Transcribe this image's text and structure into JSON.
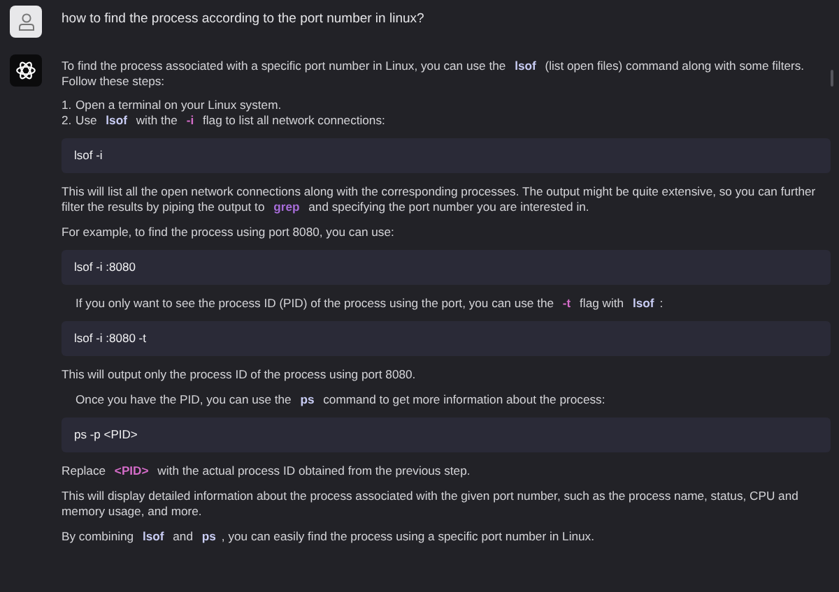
{
  "question": "how to find the process according to the port number in linux?",
  "answer": [
    {
      "kind": "paragraph",
      "indented": false,
      "segments": [
        {
          "kind": "text",
          "text": "To find the process associated with a specific port number in Linux, you can use the "
        },
        {
          "kind": "code",
          "text": "lsof",
          "color": "#c9cdf5"
        },
        {
          "kind": "text",
          "text": " (list open files) command along with some filters. Follow these steps:"
        }
      ]
    },
    {
      "kind": "list",
      "items": [
        {
          "number": "1.",
          "segments": [
            {
              "kind": "text",
              "text": "Open a terminal on your Linux system."
            }
          ]
        },
        {
          "number": "2.",
          "segments": [
            {
              "kind": "text",
              "text": "Use "
            },
            {
              "kind": "code",
              "text": "lsof",
              "color": "#c9cdf5"
            },
            {
              "kind": "text",
              "text": " with the "
            },
            {
              "kind": "code",
              "text": "-i",
              "color": "#d46cc8"
            },
            {
              "kind": "text",
              "text": " flag to list all network connections:"
            }
          ]
        }
      ]
    },
    {
      "kind": "code",
      "text": "lsof -i"
    },
    {
      "kind": "paragraph",
      "indented": false,
      "segments": [
        {
          "kind": "text",
          "text": "This will list all the open network connections along with the corresponding processes. The output might be quite extensive, so you can further filter the results by piping the output to "
        },
        {
          "kind": "code",
          "text": "grep",
          "color": "#a66cd8"
        },
        {
          "kind": "text",
          "text": " and specifying the port number you are interested in."
        }
      ]
    },
    {
      "kind": "paragraph",
      "indented": false,
      "segments": [
        {
          "kind": "text",
          "text": "For example, to find the process using port 8080, you can use:"
        }
      ]
    },
    {
      "kind": "code",
      "text": "lsof -i :8080"
    },
    {
      "kind": "paragraph",
      "indented": true,
      "segments": [
        {
          "kind": "text",
          "text": "If you only want to see the process ID (PID) of the process using the port, you can use the "
        },
        {
          "kind": "code",
          "text": "-t",
          "color": "#d46cc8"
        },
        {
          "kind": "text",
          "text": " flag with "
        },
        {
          "kind": "code",
          "text": "lsof",
          "color": "#c9cdf5"
        },
        {
          "kind": "text",
          "text": ":"
        }
      ]
    },
    {
      "kind": "code",
      "text": "lsof -i :8080 -t"
    },
    {
      "kind": "paragraph",
      "indented": false,
      "segments": [
        {
          "kind": "text",
          "text": "This will output only the process ID of the process using port 8080."
        }
      ]
    },
    {
      "kind": "paragraph",
      "indented": true,
      "segments": [
        {
          "kind": "text",
          "text": "Once you have the PID, you can use the "
        },
        {
          "kind": "code",
          "text": "ps",
          "color": "#c9cdf5"
        },
        {
          "kind": "text",
          "text": " command to get more information about the process:"
        }
      ]
    },
    {
      "kind": "code",
      "text": "ps -p <PID>"
    },
    {
      "kind": "paragraph",
      "indented": false,
      "segments": [
        {
          "kind": "text",
          "text": "Replace "
        },
        {
          "kind": "code",
          "text": "<PID>",
          "color": "#d46cc8"
        },
        {
          "kind": "text",
          "text": " with the actual process ID obtained from the previous step."
        }
      ]
    },
    {
      "kind": "paragraph",
      "indented": false,
      "segments": [
        {
          "kind": "text",
          "text": "This will display detailed information about the process associated with the given port number, such as the process name, status, CPU and memory usage, and more."
        }
      ]
    },
    {
      "kind": "paragraph",
      "indented": false,
      "segments": [
        {
          "kind": "text",
          "text": "By combining "
        },
        {
          "kind": "code",
          "text": "lsof",
          "color": "#c9cdf5"
        },
        {
          "kind": "text",
          "text": " and "
        },
        {
          "kind": "code",
          "text": "ps",
          "color": "#c9cdf5"
        },
        {
          "kind": "text",
          "text": ", you can easily find the process using a specific port number in Linux."
        }
      ]
    }
  ]
}
